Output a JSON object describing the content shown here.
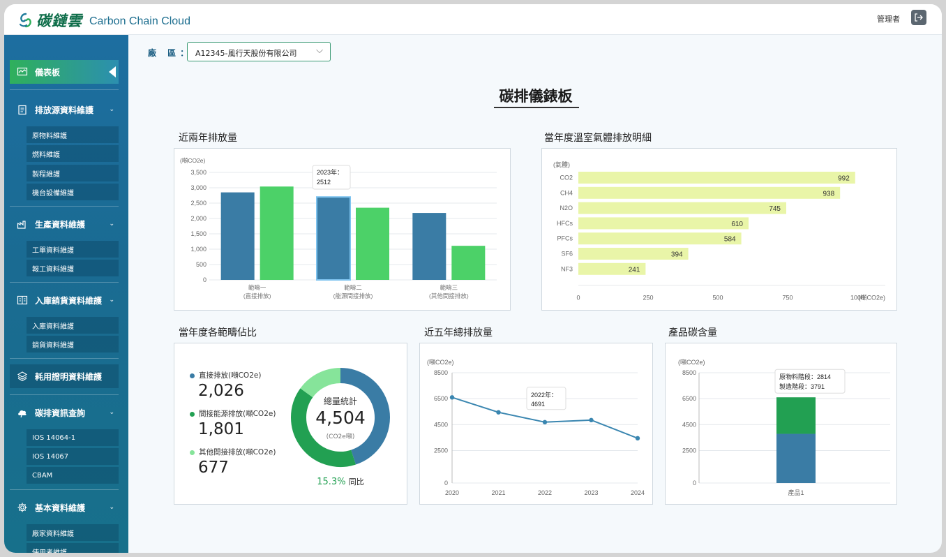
{
  "app": {
    "brand_zh": "碳鏈雲",
    "brand_en": "Carbon Chain Cloud",
    "user": "管理者"
  },
  "sidebar": {
    "active": "儀表板",
    "groups": [
      {
        "label": "排放源資料維護",
        "items": [
          "原物料維護",
          "燃料維護",
          "製程維護",
          "機台設備維護"
        ]
      },
      {
        "label": "生產資料維護",
        "items": [
          "工單資料維護",
          "報工資料維護"
        ]
      },
      {
        "label": "入庫銷貨資料維護",
        "items": [
          "入庫資料維護",
          "銷貨資料維護"
        ]
      },
      {
        "label": "耗用證明資料維護",
        "items": []
      },
      {
        "label": "碳排資訊查詢",
        "items": [
          "IOS 14064-1",
          "IOS 14067",
          "CBAM"
        ]
      },
      {
        "label": "基本資料維護",
        "items": [
          "廠家資料維護",
          "使用者維護"
        ]
      }
    ]
  },
  "filter": {
    "label": "廠 區：",
    "value": "A12345-風行天股份有限公司"
  },
  "page_title": "碳排儀錶板",
  "sections": {
    "yearly": "近兩年排放量",
    "gases": "當年度溫室氣體排放明細",
    "scopes": "當年度各範疇佔比",
    "five_year": "近五年總排放量",
    "product": "產品碳含量"
  },
  "chart_data": [
    {
      "type": "bar",
      "ylabel": "(噸CO2e)",
      "ylim": [
        0,
        3500
      ],
      "yticks": [
        "3,500",
        "3,000",
        "2,500",
        "2,000",
        "1,500",
        "1,000",
        "500",
        "0"
      ],
      "categories": [
        "範疇一\n(直接排放)",
        "範疇二\n(能源間接排放)",
        "範疇三\n(其他間接排放)"
      ],
      "series": [
        {
          "values": [
            2850,
            2700,
            2180
          ],
          "color": "#3a7ca5"
        },
        {
          "values": [
            3040,
            2350,
            1110
          ],
          "color": "#4cd168"
        }
      ],
      "tooltip": {
        "title": "2023年：",
        "value": "2512"
      }
    },
    {
      "type": "bar",
      "orientation": "horizontal",
      "ylabel": "(氣體)",
      "xlabel": "(噸CO2e)",
      "xlim": [
        0,
        1000
      ],
      "xticks": [
        "0",
        "250",
        "500",
        "750",
        "1000"
      ],
      "categories": [
        "CO2",
        "CH4",
        "N2O",
        "HFCs",
        "PFCs",
        "SF6",
        "NF3"
      ],
      "values": [
        992,
        938,
        745,
        610,
        584,
        394,
        241
      ],
      "color": "#e9f5a8"
    },
    {
      "type": "pie",
      "center_title": "總量統計",
      "center_value": "4,504",
      "center_unit": "(CO2e噸)",
      "yoy_value": "15.3%",
      "yoy_label": "同比",
      "slices": [
        {
          "label": "直接排放(噸CO2e)",
          "display": "2,026",
          "value": 2026,
          "color": "#3a7ca5"
        },
        {
          "label": "間接能源排放(噸CO2e)",
          "display": "1,801",
          "value": 1801,
          "color": "#22a052"
        },
        {
          "label": "其他間接排放(噸CO2e)",
          "display": "677",
          "value": 677,
          "color": "#86e49a"
        }
      ]
    },
    {
      "type": "line",
      "ylabel": "(噸CO2e)",
      "ylim": [
        0,
        8500
      ],
      "yticks": [
        "8500",
        "6500",
        "4500",
        "2500",
        "0"
      ],
      "x": [
        "2020",
        "2021",
        "2022",
        "2023",
        "2024"
      ],
      "values": [
        6600,
        5450,
        4691,
        4850,
        3450
      ],
      "color": "#3a86b0",
      "tooltip": {
        "title": "2022年：",
        "value": "4691"
      }
    },
    {
      "type": "bar",
      "stacked": true,
      "ylabel": "(噸CO2e)",
      "ylim": [
        0,
        8500
      ],
      "yticks": [
        "8500",
        "6500",
        "4500",
        "2500",
        "0"
      ],
      "categories": [
        "產品1"
      ],
      "series": [
        {
          "name": "製造階段",
          "values": [
            3791
          ],
          "color": "#3a7ca5"
        },
        {
          "name": "原物料階段",
          "values": [
            2814
          ],
          "color": "#22a052"
        }
      ],
      "tooltip": {
        "lines": [
          "原物料階段：2814",
          "製造階段：3791"
        ]
      }
    }
  ]
}
